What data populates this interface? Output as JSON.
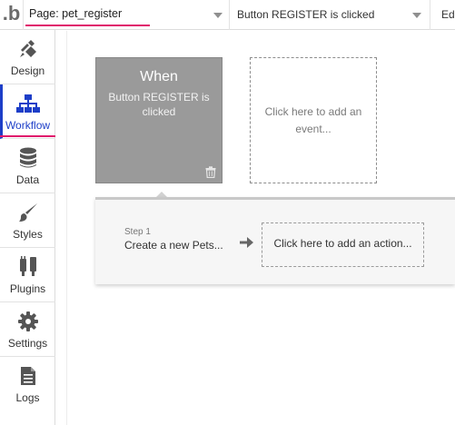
{
  "topbar": {
    "logo_text": ".b",
    "page_selector": "Page: pet_register",
    "event_selector": "Button REGISTER is clicked",
    "edit_tab": "Ed"
  },
  "sidebar": {
    "items": [
      {
        "label": "Design",
        "icon": "design-icon"
      },
      {
        "label": "Workflow",
        "icon": "workflow-icon",
        "active": true
      },
      {
        "label": "Data",
        "icon": "database-icon"
      },
      {
        "label": "Styles",
        "icon": "brush-icon"
      },
      {
        "label": "Plugins",
        "icon": "plug-icon"
      },
      {
        "label": "Settings",
        "icon": "gear-icon"
      },
      {
        "label": "Logs",
        "icon": "document-icon"
      }
    ]
  },
  "workflow": {
    "event_card": {
      "title": "When",
      "description": "Button REGISTER is clicked"
    },
    "add_event_text": "Click here to add an event...",
    "step": {
      "number_label": "Step 1",
      "name": "Create a new Pets..."
    },
    "add_action_text": "Click here to add an action..."
  },
  "colors": {
    "accent_pink": "#e0186c",
    "active_blue": "#1d3ec8",
    "event_card_gray": "#9a9a9a"
  }
}
